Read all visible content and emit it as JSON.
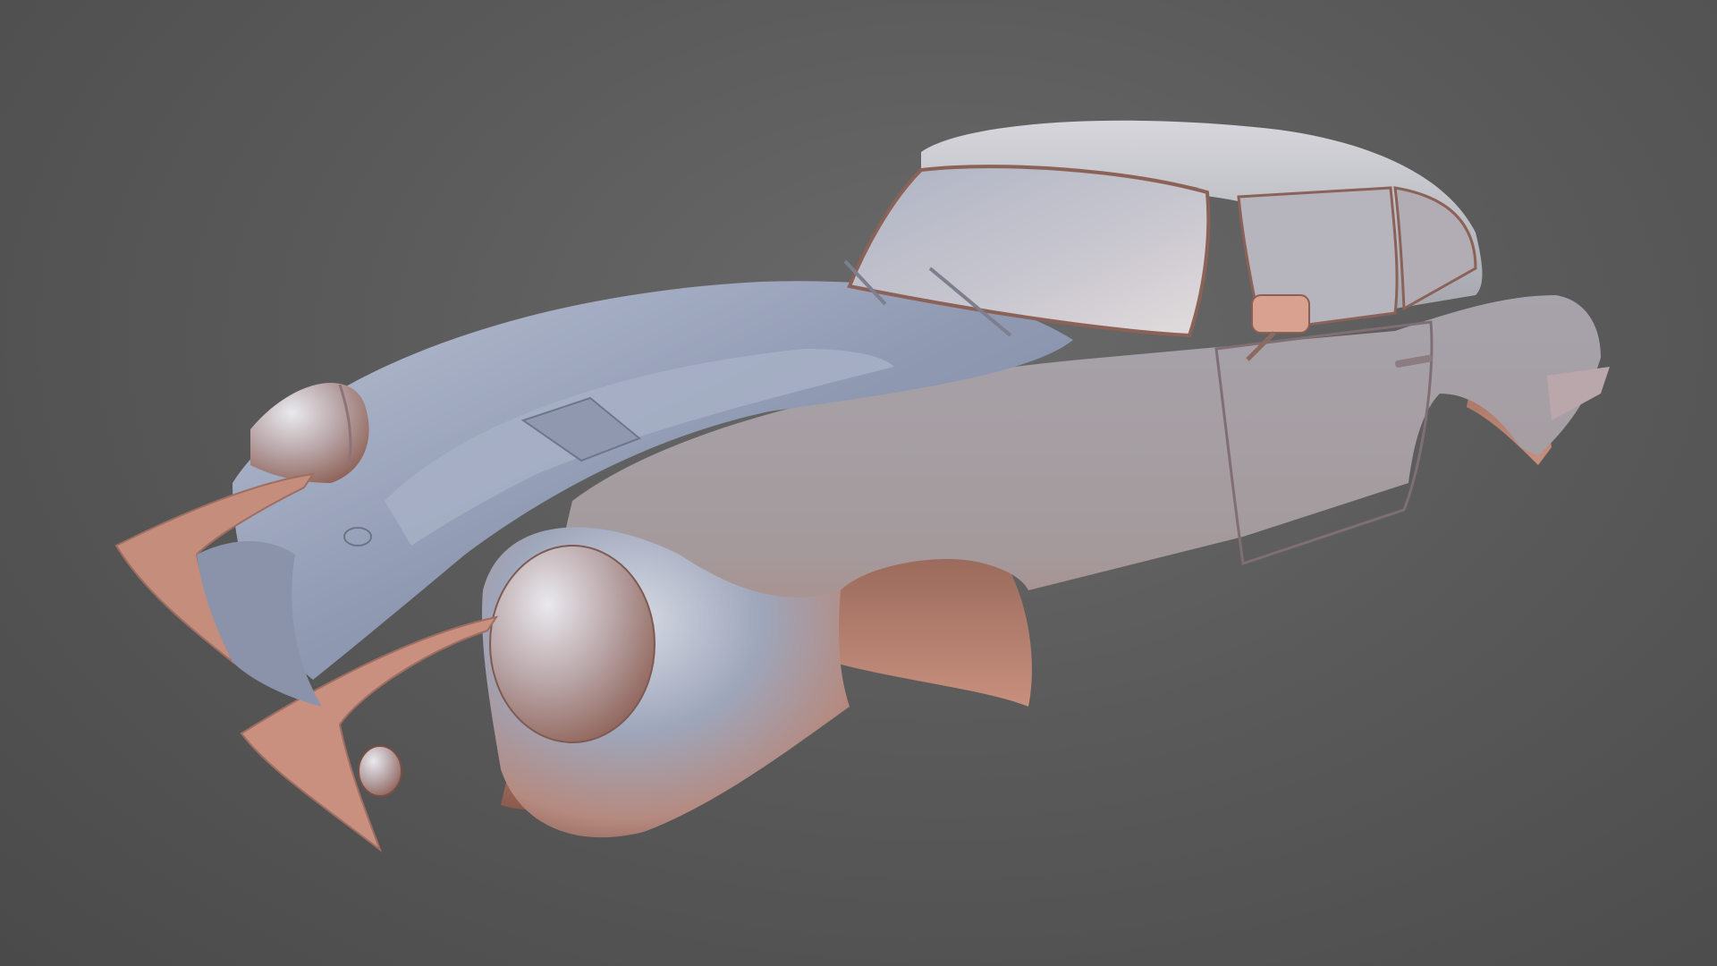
{
  "scene": {
    "subject": "car-body-shell-3d-render",
    "colors": {
      "background_center": "#6a6a6a",
      "background_edge": "#4a4a4a",
      "body_highlight": "#c9ccd6",
      "body_blue": "#8e97ad",
      "body_mid": "#a39ea3",
      "body_warm": "#c08878",
      "body_shadow": "#8a5a4c",
      "interior_shadow": "#7a4e42"
    }
  }
}
